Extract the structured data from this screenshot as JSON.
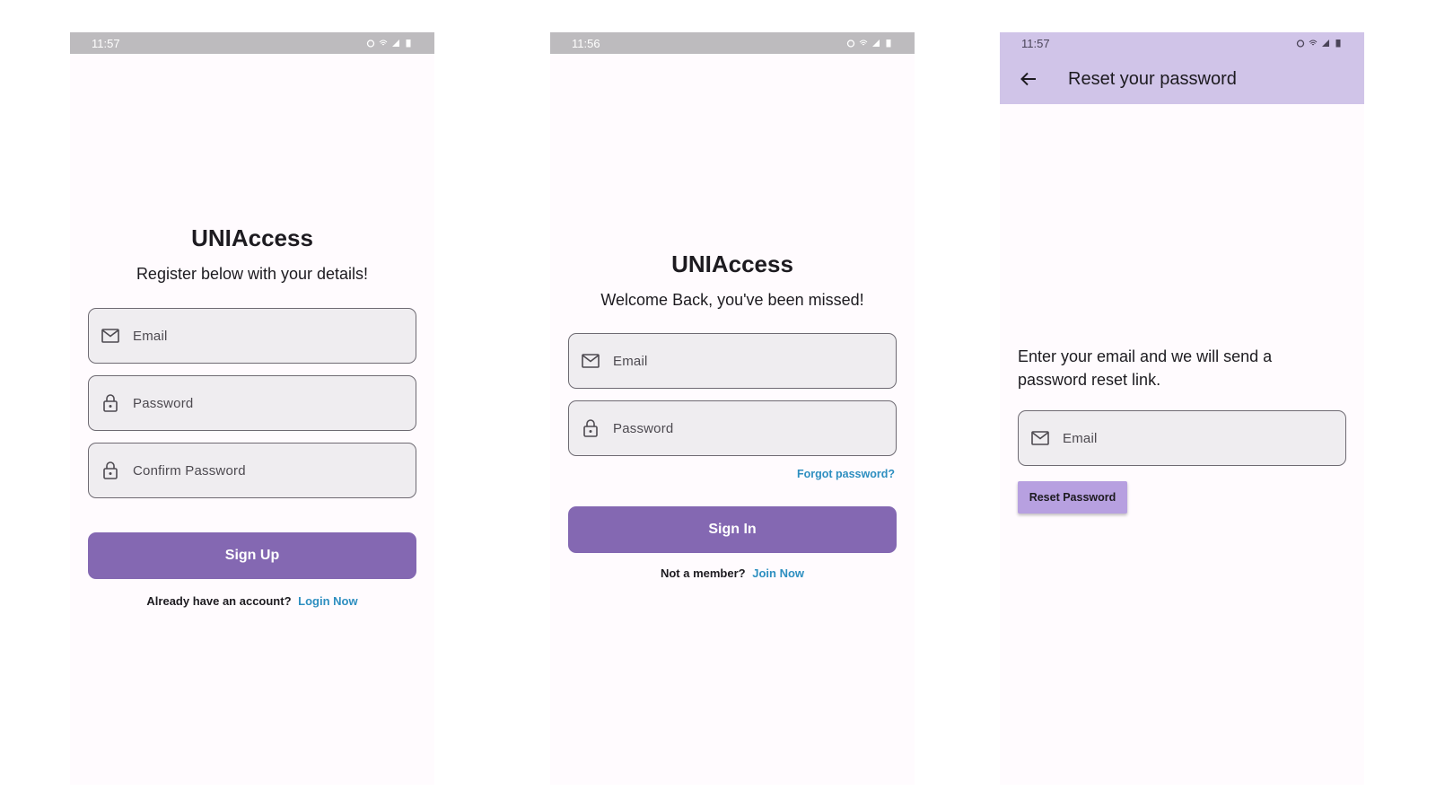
{
  "register": {
    "status_time": "11:57",
    "app_title": "UNIAccess",
    "subtitle": "Register below with your details!",
    "email_placeholder": "Email",
    "password_placeholder": "Password",
    "confirm_placeholder": "Confirm Password",
    "signup_label": "Sign Up",
    "footer_text": "Already have an account?",
    "footer_link": "Login Now"
  },
  "login": {
    "status_time": "11:56",
    "app_title": "UNIAccess",
    "subtitle": "Welcome Back, you've been missed!",
    "email_placeholder": "Email",
    "password_placeholder": "Password",
    "forgot_label": "Forgot password?",
    "signin_label": "Sign In",
    "footer_text": "Not a member?",
    "footer_link": "Join Now"
  },
  "reset": {
    "status_time": "11:57",
    "appbar_title": "Reset your password",
    "description": "Enter your email and we will send a password reset link.",
    "email_placeholder": "Email",
    "reset_label": "Reset Password"
  },
  "colors": {
    "primary": "#8468b2",
    "appbar": "#d0c4e8",
    "link": "#2e8fc0",
    "reset_button": "#b7a0e0"
  },
  "icons": [
    "mail-icon",
    "lock-icon",
    "back-arrow-icon",
    "alarm-icon",
    "wifi-icon",
    "signal-icon",
    "battery-icon"
  ]
}
